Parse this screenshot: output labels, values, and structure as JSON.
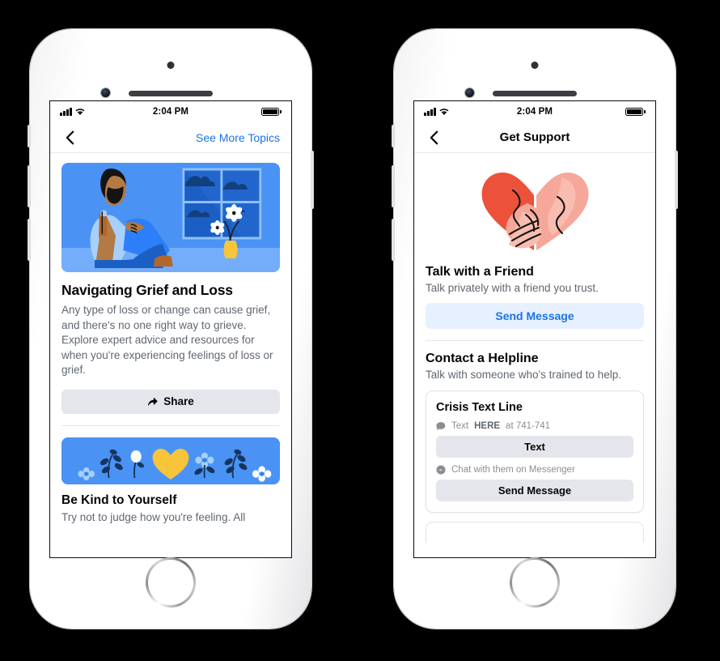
{
  "left_phone": {
    "status_bar": {
      "time": "2:04 PM",
      "signal_icon": "cellular-bars-icon",
      "wifi_icon": "wifi-icon",
      "battery_icon": "battery-full-icon"
    },
    "nav": {
      "back_icon": "chevron-left-icon",
      "action_label": "See More Topics"
    },
    "hero_illustration": "seated-man-by-window-illustration",
    "article": {
      "title": "Navigating Grief and Loss",
      "description": "Any type of loss or change can cause grief, and there's no one right way to grieve. Explore expert advice and resources for when you're experiencing feelings of loss or grief."
    },
    "share_button": {
      "label": "Share",
      "icon": "share-arrow-icon"
    },
    "next_article": {
      "banner_illustration": "flowers-and-heart-banner-illustration",
      "title": "Be Kind to Yourself",
      "description": "Try not to judge how you're feeling. All"
    }
  },
  "right_phone": {
    "status_bar": {
      "time": "2:04 PM",
      "signal_icon": "cellular-bars-icon",
      "wifi_icon": "wifi-icon",
      "battery_icon": "battery-full-icon"
    },
    "nav": {
      "back_icon": "chevron-left-icon",
      "title": "Get Support"
    },
    "hero_illustration": "clasped-hands-heart-illustration",
    "friend_section": {
      "title": "Talk with a Friend",
      "subtitle": "Talk privately with a friend you trust.",
      "button_label": "Send Message"
    },
    "helpline_section": {
      "title": "Contact a Helpline",
      "subtitle": "Talk with someone who's trained to help."
    },
    "helpline_card": {
      "name": "Crisis Text Line",
      "text_note_prefix": "Text ",
      "text_note_keyword": "HERE",
      "text_note_suffix": " at 741-741",
      "text_note_icon": "speech-bubble-icon",
      "text_button_label": "Text",
      "messenger_note": "Chat with them on Messenger",
      "messenger_icon": "messenger-icon",
      "messenger_button_label": "Send Message"
    }
  },
  "colors": {
    "accent_blue": "#1b74e4",
    "light_blue_bg": "#e7f0fe",
    "grey_button": "#e4e6eb",
    "banner_blue": "#4a93f5",
    "heart_yellow": "#f8c43a",
    "heart_red": "#ec513a",
    "heart_pink": "#f5a79a"
  }
}
